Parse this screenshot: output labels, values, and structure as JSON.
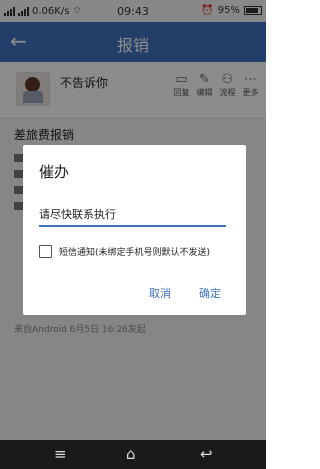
{
  "status_bar": {
    "network_speed": "0.06K/s",
    "time": "09:43",
    "battery": "95%"
  },
  "header": {
    "title": "报销"
  },
  "post": {
    "username": "不告诉你",
    "actions": [
      {
        "label": "回复",
        "icon": "comment-icon"
      },
      {
        "label": "编辑",
        "icon": "edit-icon"
      },
      {
        "label": "流程",
        "icon": "flow-icon"
      },
      {
        "label": "更多",
        "icon": "more-icon"
      }
    ],
    "section_title": "差旅费报销",
    "source_text": "来自Android  6月5日  16:26发起"
  },
  "dialog": {
    "title": "催办",
    "input_value": "请尽快联系执行",
    "sms_checkbox_label": "短信通知(未绑定手机号则默认不发送)",
    "sms_checked": false,
    "cancel_label": "取消",
    "ok_label": "确定"
  },
  "nav_bar": {
    "items": [
      "menu-icon",
      "home-icon",
      "back-icon"
    ]
  }
}
